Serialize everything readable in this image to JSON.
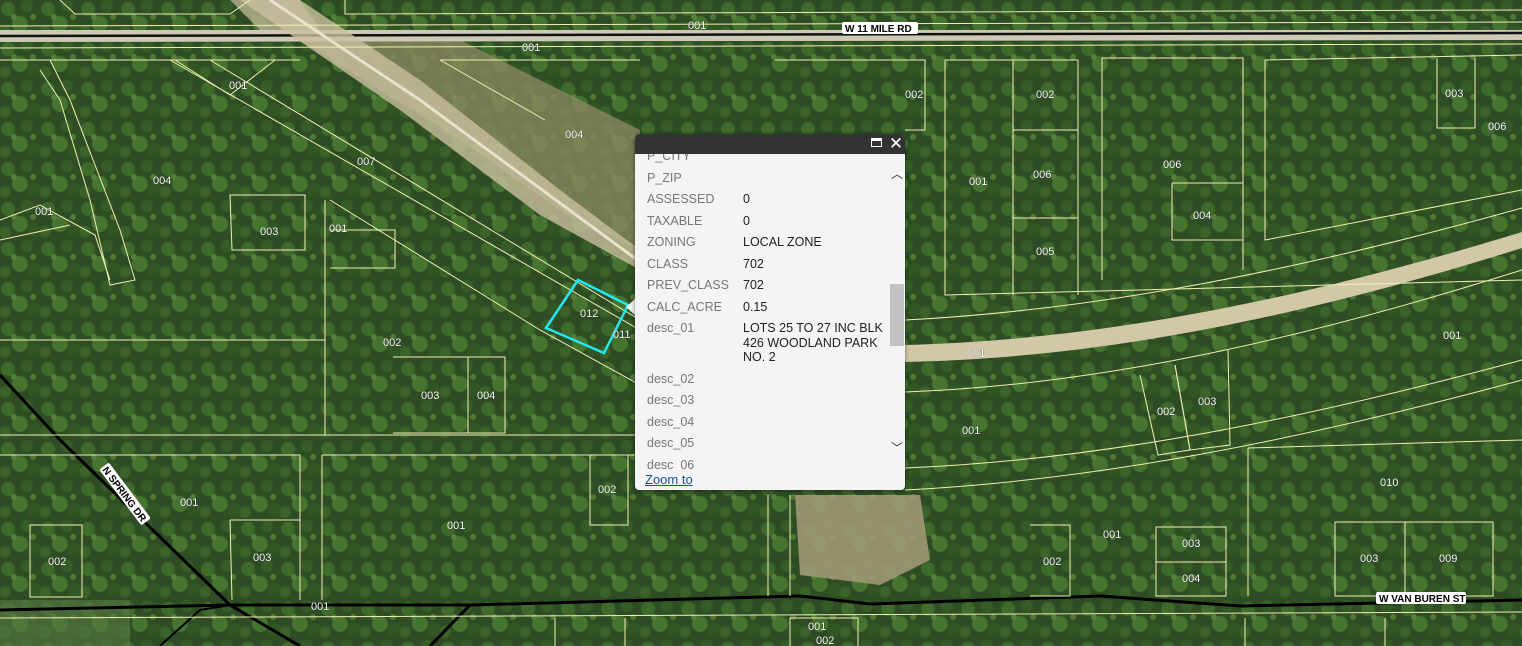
{
  "map": {
    "roads": {
      "w_11_mile_rd": "W 11 MILE RD",
      "n_spring_dr": "N SPRING DR",
      "w_van_buren_st": "W VAN BUREN ST"
    },
    "parcel_labels": [
      "001",
      "001",
      "001",
      "001",
      "001",
      "002",
      "003",
      "004",
      "005",
      "006",
      "007",
      "004",
      "001",
      "003",
      "002",
      "003",
      "004",
      "002",
      "006",
      "004",
      "003",
      "006",
      "001",
      "001",
      "002",
      "003",
      "001",
      "010",
      "001",
      "002",
      "003",
      "004",
      "001",
      "002",
      "001",
      "002",
      "003",
      "009",
      "001",
      "001",
      "002",
      "012",
      "011"
    ],
    "selected_parcel": "012",
    "colors": {
      "parcel_line": "#f0f0b0",
      "selection": "#22e8f0",
      "road_line": "#000000"
    }
  },
  "popup": {
    "rows": [
      {
        "key": "P_CITY",
        "value": ""
      },
      {
        "key": "P_ZIP",
        "value": ""
      },
      {
        "key": "ASSESSED",
        "value": "0"
      },
      {
        "key": "TAXABLE",
        "value": "0"
      },
      {
        "key": "ZONING",
        "value": "LOCAL ZONE"
      },
      {
        "key": "CLASS",
        "value": "702"
      },
      {
        "key": "PREV_CLASS",
        "value": "702"
      },
      {
        "key": "CALC_ACRE",
        "value": "0.15"
      },
      {
        "key": "desc_01",
        "value": "LOTS 25 TO 27 INC BLK 426 WOODLAND PARK NO. 2"
      },
      {
        "key": "desc_02",
        "value": ""
      },
      {
        "key": "desc_03",
        "value": ""
      },
      {
        "key": "desc_04",
        "value": ""
      },
      {
        "key": "desc_05",
        "value": ""
      },
      {
        "key": "desc_06",
        "value": ""
      }
    ],
    "close_symbol": "✕",
    "scroll_up_symbol": "︿",
    "scroll_down_symbol": "﹀",
    "zoom_to_label": "Zoom to"
  }
}
